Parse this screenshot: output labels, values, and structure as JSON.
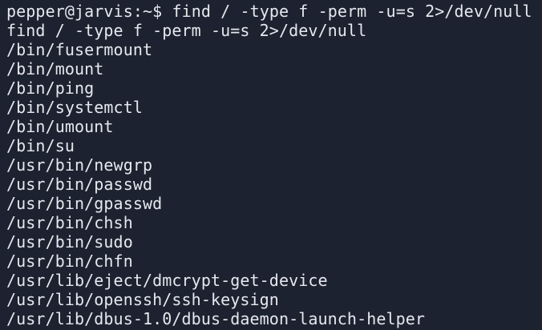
{
  "terminal": {
    "prompt": {
      "user_host": "pepper@jarvis",
      "separator": ":",
      "path": "~",
      "symbol": "$ ",
      "command": "find / -type f -perm -u=s 2>/dev/null"
    },
    "echo_line": "find / -type f -perm -u=s 2>/dev/null",
    "output": [
      "/bin/fusermount",
      "/bin/mount",
      "/bin/ping",
      "/bin/systemctl",
      "/bin/umount",
      "/bin/su",
      "/usr/bin/newgrp",
      "/usr/bin/passwd",
      "/usr/bin/gpasswd",
      "/usr/bin/chsh",
      "/usr/bin/sudo",
      "/usr/bin/chfn",
      "/usr/lib/eject/dmcrypt-get-device",
      "/usr/lib/openssh/ssh-keysign",
      "/usr/lib/dbus-1.0/dbus-daemon-launch-helper"
    ]
  },
  "colors": {
    "background": "#1d2230",
    "foreground": "#e6e8ee"
  }
}
